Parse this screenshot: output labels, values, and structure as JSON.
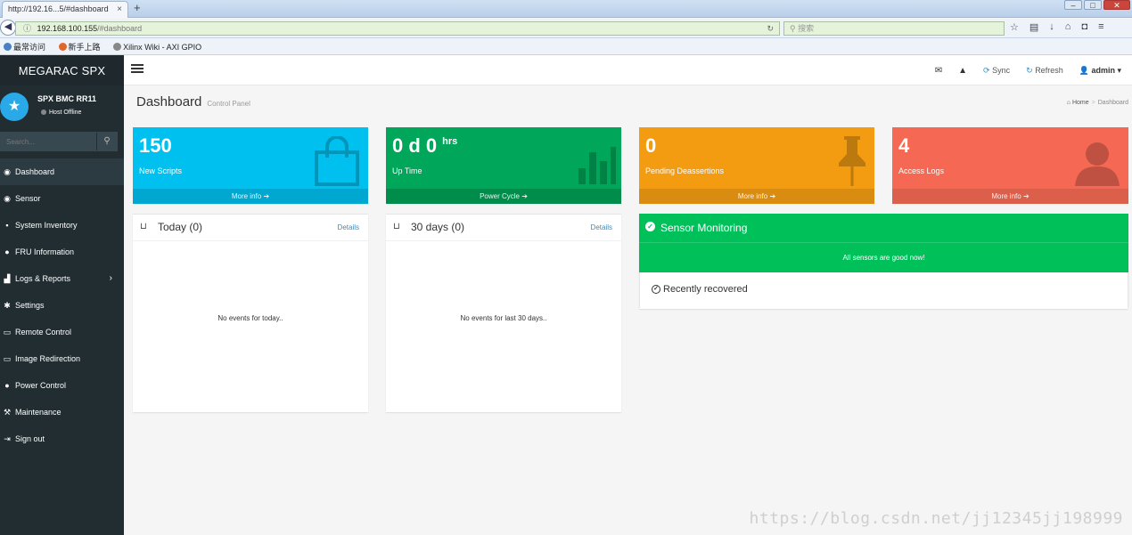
{
  "browser": {
    "tab_title": "http://192.16...5/#dashboard",
    "tab_close": "×",
    "new_tab": "+",
    "url_host": "192.168.100.155",
    "url_path": "/#dashboard",
    "search_placeholder": "搜索",
    "bookmarks": [
      "最常访问",
      "新手上路",
      "Xilinx Wiki - AXI GPIO"
    ]
  },
  "sidebar": {
    "brand": "MEGARAC SPX",
    "host_name": "SPX BMC RR11",
    "host_status": "Host Offline",
    "search_placeholder": "Search...",
    "items": [
      {
        "label": "Dashboard",
        "icon": "dashboard-icon",
        "active": true
      },
      {
        "label": "Sensor",
        "icon": "sensor-icon"
      },
      {
        "label": "System Inventory",
        "icon": "inventory-icon"
      },
      {
        "label": "FRU Information",
        "icon": "info-icon"
      },
      {
        "label": "Logs & Reports",
        "icon": "bar-chart-icon",
        "has_submenu": true
      },
      {
        "label": "Settings",
        "icon": "gear-icon"
      },
      {
        "label": "Remote Control",
        "icon": "monitor-icon"
      },
      {
        "label": "Image Redirection",
        "icon": "drive-icon"
      },
      {
        "label": "Power Control",
        "icon": "power-icon"
      },
      {
        "label": "Maintenance",
        "icon": "wrench-icon"
      },
      {
        "label": "Sign out",
        "icon": "sign-out-icon"
      }
    ]
  },
  "topbar": {
    "sync": "Sync",
    "refresh": "Refresh",
    "user": "admin"
  },
  "page": {
    "title": "Dashboard",
    "subtitle": "Control Panel",
    "breadcrumb_home": "Home",
    "breadcrumb_current": "Dashboard"
  },
  "boxes": [
    {
      "value": "150",
      "label": "New Scripts",
      "footer": "More info",
      "color": "#00c0ef"
    },
    {
      "value": "0 d 0",
      "unit": "hrs",
      "label": "Up Time",
      "footer": "Power Cycle",
      "color": "#00a65a"
    },
    {
      "value": "0",
      "label": "Pending Deassertions",
      "footer": "More info",
      "color": "#f39c12"
    },
    {
      "value": "4",
      "label": "Access Logs",
      "footer": "More info",
      "color": "#f56954"
    }
  ],
  "events_today": {
    "title": "Today (0)",
    "details": "Details",
    "empty": "No events for today.."
  },
  "events_30": {
    "title": "30 days (0)",
    "details": "Details",
    "empty": "No events for last 30 days.."
  },
  "sensor": {
    "title": "Sensor Monitoring",
    "status": "All sensors are good now!",
    "recent": "Recently recovered"
  },
  "watermark": "https://blog.csdn.net/jj12345jj198999"
}
